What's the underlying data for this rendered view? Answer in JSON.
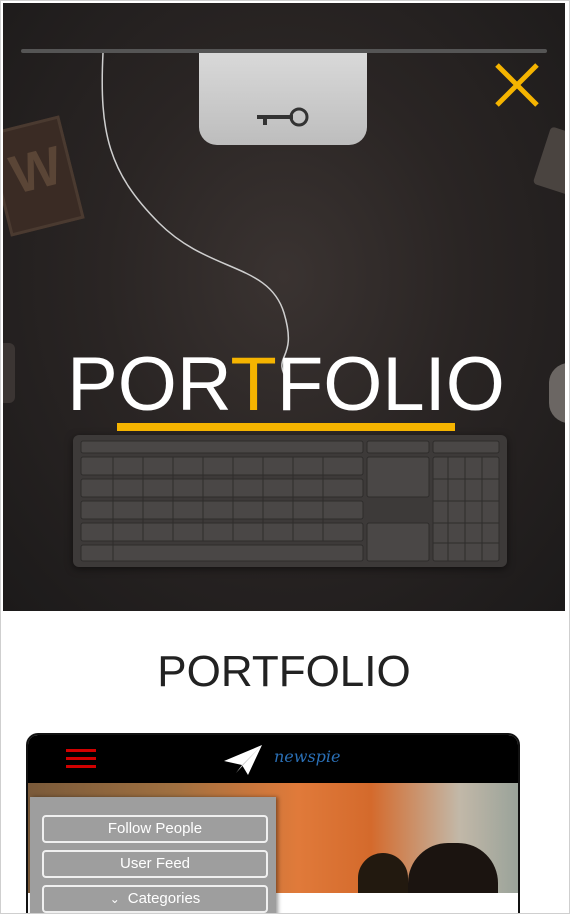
{
  "hero": {
    "title_part1": "POR",
    "title_accent": "T",
    "title_part2": "FOLIO",
    "accent_color": "#f5b400"
  },
  "close_icon": "close-icon",
  "section": {
    "title": "PORTFOLIO"
  },
  "preview": {
    "logo_text": "newspie",
    "menu": {
      "items": [
        {
          "label": "Follow People"
        },
        {
          "label": "User Feed"
        },
        {
          "label": "Categories",
          "icon": "chevron-down-icon"
        }
      ]
    }
  }
}
